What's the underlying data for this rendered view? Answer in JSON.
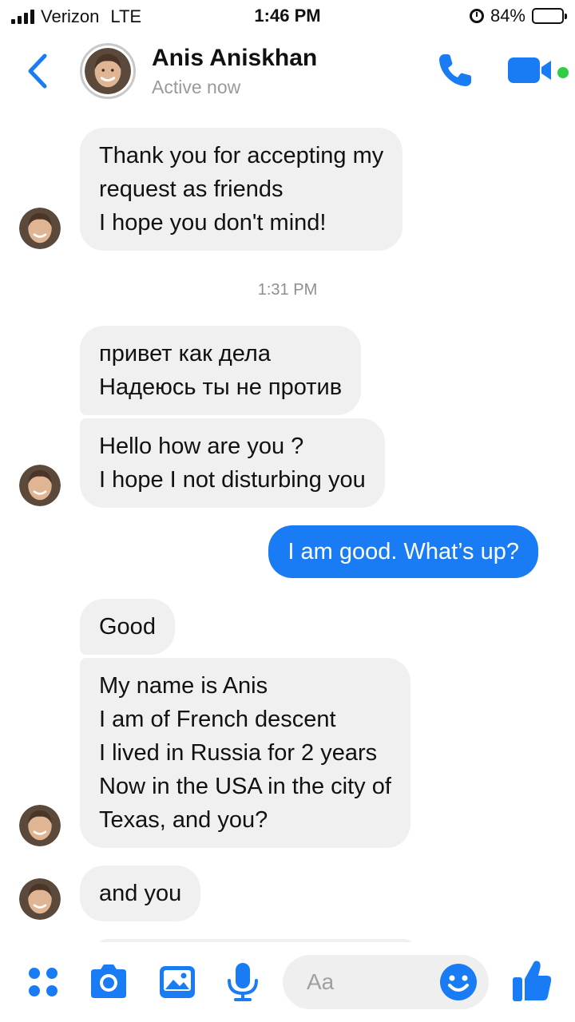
{
  "status_bar": {
    "carrier": "Verizon",
    "network": "LTE",
    "time": "1:46 PM",
    "battery": "84%",
    "battery_level": 0.84
  },
  "header": {
    "name": "Anis Aniskhan",
    "status": "Active now",
    "back_icon": "chevron-left-icon",
    "call_icon": "phone-icon",
    "video_icon": "video-camera-icon"
  },
  "thread": {
    "messages": [
      {
        "from": "contact",
        "text": "Thank you for accepting my\nrequest as friends\nI hope you don't mind!"
      },
      {
        "type": "timestamp",
        "text": "1:31 PM"
      },
      {
        "from": "contact",
        "text": "привет как дела\nНадеюсь ты не против"
      },
      {
        "from": "contact",
        "text": "Hello how are you ?\nI hope I not disturbing you"
      },
      {
        "from": "me",
        "text": "I am good. What’s up?"
      },
      {
        "from": "contact",
        "text": "Good"
      },
      {
        "from": "contact",
        "text": "My name is Anis\nI am of French descent\nI lived in Russia for 2 years\nNow in the USA in the city of\nTexas, and you?"
      },
      {
        "from": "contact",
        "text": "and you"
      }
    ]
  },
  "composer": {
    "placeholder": "Aa",
    "icons": [
      "apps-grid-icon",
      "camera-icon",
      "photo-icon",
      "microphone-icon",
      "emoji-icon",
      "thumbs-up-icon"
    ]
  },
  "colors": {
    "accent": "#1a7cf5",
    "incoming_bubble": "#f0f0f0",
    "online": "#31cc46"
  }
}
